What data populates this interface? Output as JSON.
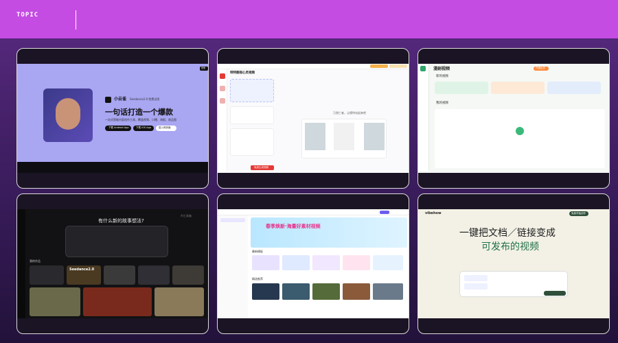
{
  "header": {
    "label": "TOPIC"
  },
  "c1": {
    "brand": "小云雀",
    "tagline": "Seedance2.0 免费试用",
    "headline": "一句话打造一个爆款",
    "subline": "一站式智能内容创作工具，覆盖视频、口播、海报、商品图",
    "btn_android": "下载 Android App",
    "btn_ios": "下载 iOS App",
    "btn_web": "进入网页版",
    "login": "登录"
  },
  "c2": {
    "title": "特特图视心灵视频",
    "sub": "万偿亡者，让模特站起来吧",
    "btn": "免费生成视频"
  },
  "c3": {
    "title": "漫剧视频",
    "section1": "新的视频",
    "section2": "我的视频",
    "badge": "开通会员"
  },
  "c4": {
    "prompt": "有什么新的故事想法?",
    "section": "我的作品",
    "thumb1": "Seedance2.0",
    "watermark": "AI工具箱"
  },
  "c5": {
    "banner": "春季焕新·海量好素材视频",
    "section1": "最新模板",
    "section2": "精选推荐"
  },
  "c6": {
    "logo": "vibehow",
    "headline1": "一键把文档／链接变成",
    "headline2": "可发布的视频",
    "btn": "免费开始创作"
  }
}
